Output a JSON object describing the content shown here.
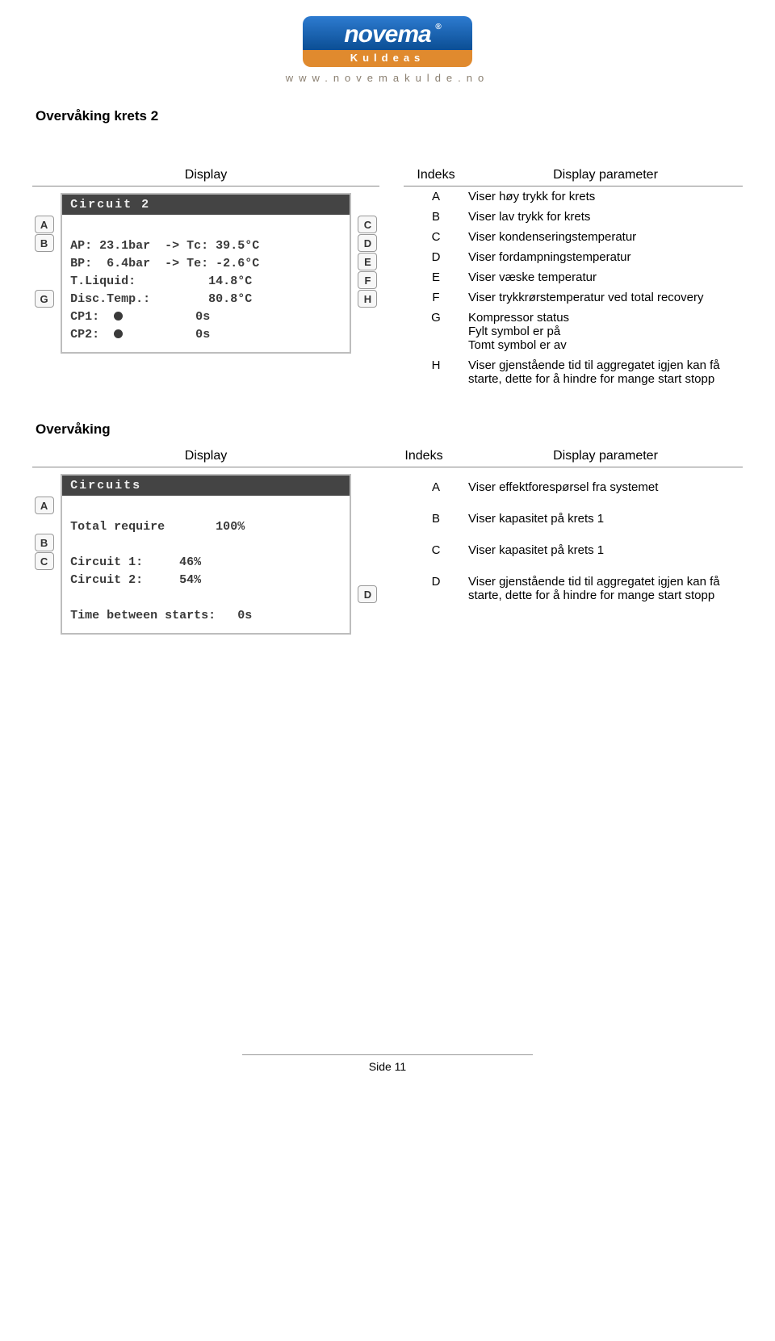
{
  "logo": {
    "brand": "novema",
    "sub": "Kuldeas",
    "url": "www.novemakulde.no"
  },
  "section1": {
    "title": "Overvåking krets 2",
    "head_display": "Display",
    "head_index": "Indeks",
    "head_param": "Display parameter",
    "screen_header": "Circuit 2",
    "screen_lines": {
      "l1": "AP: 23.1bar  -> Tc: 39.5°C",
      "l2": "BP:  6.4bar  -> Te: -2.6°C",
      "l3": "T.Liquid:          14.8°C",
      "l4": "Disc.Temp.:        80.8°C",
      "l5a": "CP1:  ",
      "l5b": "          0s",
      "l6a": "CP2:  ",
      "l6b": "          0s"
    },
    "left_letters": [
      "A",
      "B",
      "",
      "",
      "G",
      ""
    ],
    "right_letters": [
      "C",
      "D",
      "E",
      "F",
      "H"
    ],
    "rows": [
      {
        "idx": "A",
        "param": "Viser høy trykk for krets"
      },
      {
        "idx": "B",
        "param": "Viser lav trykk for krets"
      },
      {
        "idx": "C",
        "param": "Viser kondenseringstemperatur"
      },
      {
        "idx": "D",
        "param": "Viser fordampningstemperatur"
      },
      {
        "idx": "E",
        "param": "Viser væske temperatur"
      },
      {
        "idx": "F",
        "param": "Viser trykkrørstemperatur ved total recovery"
      },
      {
        "idx": "G",
        "param": "Kompressor status\nFylt symbol er på\nTomt symbol er av"
      },
      {
        "idx": "H",
        "param": "Viser gjenstående tid til aggregatet igjen kan få starte, dette for å hindre for mange start stopp"
      }
    ]
  },
  "section2": {
    "title": "Overvåking",
    "head_display": "Display",
    "head_index": "Indeks",
    "head_param": "Display parameter",
    "screen_header": "Circuits",
    "screen_lines": {
      "l1": "Total require       100%",
      "l2": "",
      "l3": "Circuit 1:     46%",
      "l4": "Circuit 2:     54%",
      "l5": "",
      "l6": "Time between starts:   0s"
    },
    "left_letters": [
      "A",
      "",
      "B",
      "C"
    ],
    "right_letters_d": "D",
    "rows": [
      {
        "idx": "A",
        "param": "Viser effektforespørsel fra systemet"
      },
      {
        "idx": "B",
        "param": "Viser kapasitet på krets 1"
      },
      {
        "idx": "C",
        "param": "Viser kapasitet på krets 1"
      },
      {
        "idx": "D",
        "param": "Viser gjenstående tid til aggregatet igjen kan få starte, dette for å hindre for mange start stopp"
      }
    ]
  },
  "footer": "Side 11",
  "chart_data": {
    "type": "table",
    "tables": [
      {
        "title": "Overvåking krets 2",
        "columns": [
          "Indeks",
          "Display parameter"
        ],
        "rows": [
          [
            "A",
            "Viser høy trykk for krets"
          ],
          [
            "B",
            "Viser lav trykk for krets"
          ],
          [
            "C",
            "Viser kondenseringstemperatur"
          ],
          [
            "D",
            "Viser fordampningstemperatur"
          ],
          [
            "E",
            "Viser væske temperatur"
          ],
          [
            "F",
            "Viser trykkrørstemperatur ved total recovery"
          ],
          [
            "G",
            "Kompressor status / Fylt symbol er på / Tomt symbol er av"
          ],
          [
            "H",
            "Viser gjenstående tid til aggregatet igjen kan få starte, dette for å hindre for mange start stopp"
          ]
        ]
      },
      {
        "title": "Overvåking",
        "columns": [
          "Indeks",
          "Display parameter"
        ],
        "rows": [
          [
            "A",
            "Viser effektforespørsel fra systemet"
          ],
          [
            "B",
            "Viser kapasitet på krets 1"
          ],
          [
            "C",
            "Viser kapasitet på krets 1"
          ],
          [
            "D",
            "Viser gjenstående tid til aggregatet igjen kan få starte, dette for å hindre for mange start stopp"
          ]
        ]
      }
    ]
  }
}
